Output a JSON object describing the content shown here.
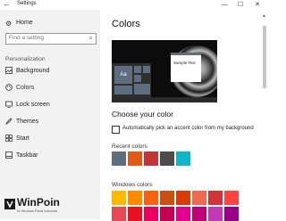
{
  "window": {
    "title": "Settings",
    "back": "←",
    "minimize": "—",
    "maximize": "☐",
    "close": "✕"
  },
  "sidebar": {
    "home": {
      "label": "Home",
      "icon": "⚙"
    },
    "search": {
      "placeholder": "Find a setting",
      "icon": "⌕"
    },
    "section": "Personalization",
    "items": [
      {
        "label": "Background",
        "icon": "🖼",
        "icon_name": "background-icon"
      },
      {
        "label": "Colors",
        "icon": "◐",
        "icon_name": "palette-icon",
        "selected": true
      },
      {
        "label": "Lock screen",
        "icon": "▭",
        "icon_name": "lock-screen-icon"
      },
      {
        "label": "Themes",
        "icon": "✎",
        "icon_name": "themes-icon"
      },
      {
        "label": "Start",
        "icon": "☷",
        "icon_name": "start-icon"
      },
      {
        "label": "Taskbar",
        "icon": "▬",
        "icon_name": "taskbar-icon"
      }
    ]
  },
  "main": {
    "title": "Colors",
    "preview": {
      "tile_label": "Aa",
      "sample_text": "Sample Text"
    },
    "choose_heading": "Choose your color",
    "auto_accent_label": "Automatically pick an accent color from my background",
    "auto_accent_checked": false,
    "recent_label": "Recent colors",
    "recent_colors": [
      "#5c6e80",
      "#e05a19",
      "#c3343a",
      "#4c4c4c",
      "#12b5c8"
    ],
    "windows_label": "Windows colors",
    "windows_colors": [
      [
        "#ffb900",
        "#ff8c00",
        "#f7630c",
        "#ca5010",
        "#da3b01",
        "#ef6950",
        "#d13438",
        "#ff4343"
      ],
      [
        "#e74856",
        "#e81123",
        "#ea005e",
        "#c30052",
        "#e3008c",
        "#bf0077",
        "#c239b3",
        "#9a0089"
      ]
    ]
  },
  "watermark": {
    "name": "WinPoin",
    "tagline": "#1 Windows Portal Indonesia"
  },
  "colors": {
    "sidebar_bg": "#f2f2f2",
    "accent": "#5c6e80"
  }
}
